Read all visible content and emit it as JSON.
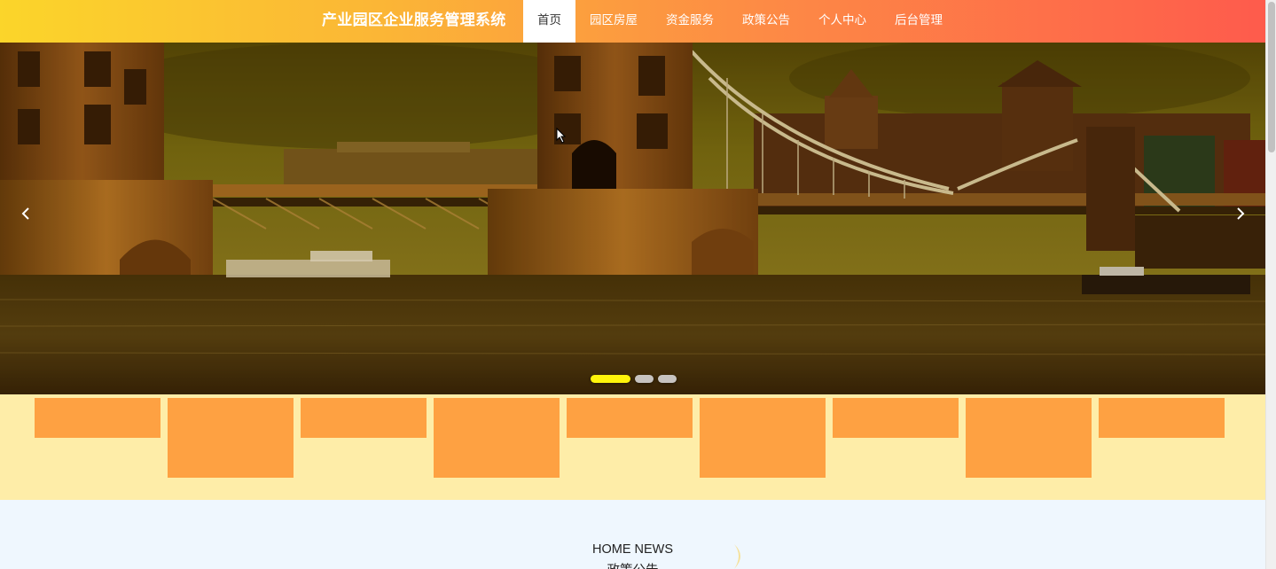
{
  "header": {
    "site_title": "产业园区企业服务管理系统",
    "nav": [
      {
        "label": "首页",
        "active": true
      },
      {
        "label": "园区房屋",
        "active": false
      },
      {
        "label": "资金服务",
        "active": false
      },
      {
        "label": "政策公告",
        "active": false
      },
      {
        "label": "个人中心",
        "active": false
      },
      {
        "label": "后台管理",
        "active": false
      }
    ]
  },
  "carousel": {
    "prev_icon": "chevron-left-icon",
    "next_icon": "chevron-right-icon",
    "slide_count": 3,
    "active_index": 0
  },
  "tiles": {
    "count": 9,
    "color": "#fea142",
    "background": "#feeda8"
  },
  "news_section": {
    "title_en": "HOME NEWS",
    "title_cn": "政策公告"
  },
  "colors": {
    "header_start": "#fbd52a",
    "header_end": "#fe5b4c",
    "active_dot": "#fff40a"
  }
}
